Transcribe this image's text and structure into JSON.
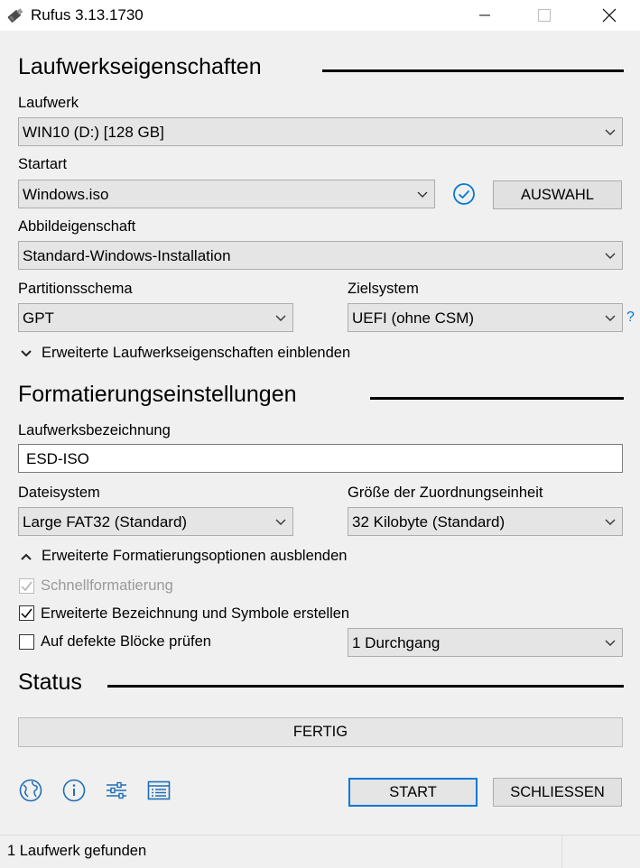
{
  "window": {
    "title": "Rufus 3.13.1730"
  },
  "drive_properties": {
    "section_title": "Laufwerkseigenschaften",
    "device_label": "Laufwerk",
    "device_value": "WIN10 (D:) [128 GB]",
    "boot_label": "Startart",
    "boot_value": "Windows.iso",
    "select_button": "AUSWAHL",
    "image_option_label": "Abbildeigenschaft",
    "image_option_value": "Standard-Windows-Installation",
    "partition_label": "Partitionsschema",
    "partition_value": "GPT",
    "target_label": "Zielsystem",
    "target_value": "UEFI (ohne CSM)",
    "help_symbol": "?",
    "advanced_toggle": "Erweiterte Laufwerkseigenschaften einblenden"
  },
  "format_options": {
    "section_title": "Formatierungseinstellungen",
    "volume_label": "Laufwerksbezeichnung",
    "volume_value": "ESD-ISO",
    "filesystem_label": "Dateisystem",
    "filesystem_value": "Large FAT32 (Standard)",
    "cluster_label": "Größe der Zuordnungseinheit",
    "cluster_value": "32 Kilobyte (Standard)",
    "advanced_toggle": "Erweiterte Formatierungsoptionen ausblenden",
    "quick_format": "Schnellformatierung",
    "extended_label": "Erweiterte Bezeichnung und Symbole erstellen",
    "bad_blocks": "Auf defekte Blöcke prüfen",
    "passes_value": "1 Durchgang"
  },
  "status": {
    "section_title": "Status",
    "progress_text": "FERTIG",
    "start_button": "START",
    "close_button": "SCHLIESSEN"
  },
  "statusbar": {
    "text": "1 Laufwerk gefunden"
  },
  "colors": {
    "accent": "#0078d7",
    "window_bg": "#f0f0f0"
  },
  "icons": [
    "usb-drive-icon",
    "globe-icon",
    "info-icon",
    "settings-sliders-icon",
    "log-icon",
    "check-circle-icon"
  ]
}
